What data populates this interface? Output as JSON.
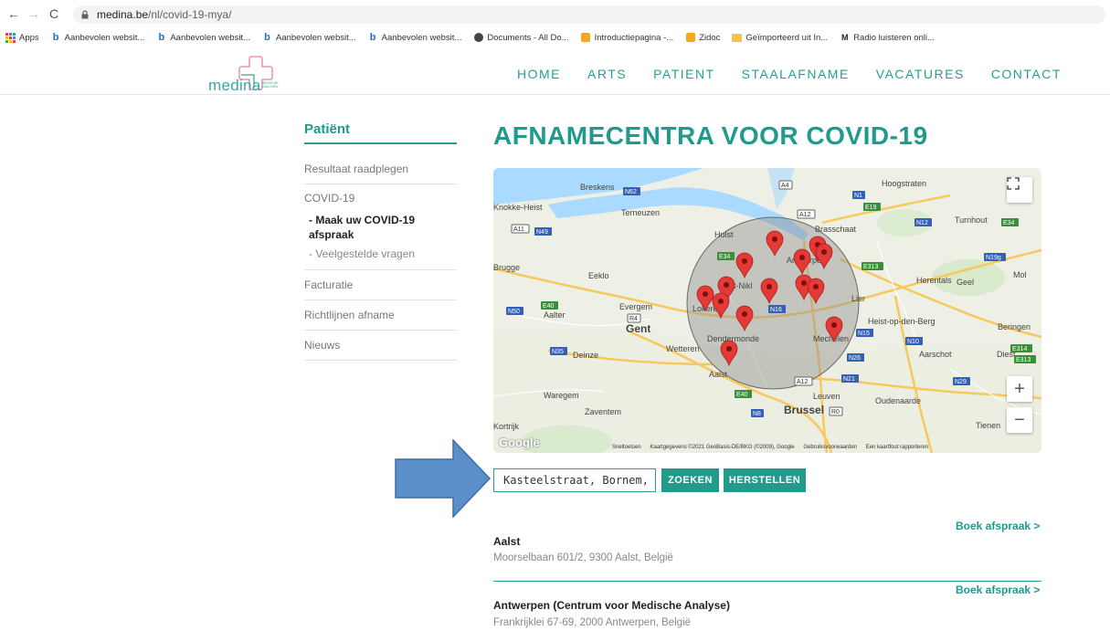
{
  "browser": {
    "url_host": "medina.be",
    "url_path": "/nl/covid-19-mya/",
    "bookmarks": [
      {
        "label": "Apps",
        "icon": "apps-grid-icon"
      },
      {
        "label": "Aanbevolen websit...",
        "icon": "bing-icon"
      },
      {
        "label": "Aanbevolen websit...",
        "icon": "bing-icon"
      },
      {
        "label": "Aanbevolen websit...",
        "icon": "bing-icon"
      },
      {
        "label": "Aanbevolen websit...",
        "icon": "bing-icon"
      },
      {
        "label": "Documents - All Do...",
        "icon": "documents-icon"
      },
      {
        "label": "Introductiepagina -...",
        "icon": "page-icon"
      },
      {
        "label": "Zidoc",
        "icon": "page-icon"
      },
      {
        "label": "Geïmporteerd uit In...",
        "icon": "folder-icon"
      },
      {
        "label": "Radio luisteren onli...",
        "icon": "radio-icon"
      }
    ]
  },
  "site": {
    "logo_text": "medina",
    "logo_sub": "MEDISCHE ANALYSEN",
    "nav": [
      "HOME",
      "ARTS",
      "PATIENT",
      "STAALAFNAME",
      "VACATURES",
      "CONTACT"
    ]
  },
  "sidebar": {
    "title": "Patiënt",
    "items": [
      "Resultaat raadplegen",
      "COVID-19",
      "Facturatie",
      "Richtlijnen afname",
      "Nieuws"
    ],
    "sub_active": "- Maak uw COVID-19 afspraak",
    "sub_other": "- Veelgestelde vragen"
  },
  "main": {
    "title": "AFNAMECENTRA VOOR COVID-19",
    "map": {
      "place_labels": [
        "Breskens",
        "Knokke-Heist",
        "Terneuzen",
        "Hulst",
        "Brasschaat",
        "Hoogstraten",
        "Turnhout",
        "Brugge",
        "Eeklo",
        "Sint-Nikl",
        "Antwerpen",
        "Herentals",
        "Geel",
        "Mol",
        "Evergem",
        "Aalter",
        "Gent",
        "Lokeren",
        "Lier",
        "Heist-op-den-Berg",
        "Beringen",
        "Wetteren",
        "Dendermonde",
        "Mechelen",
        "Deinze",
        "Aarschot",
        "Diest",
        "Aalst",
        "Waregem",
        "Zaventem",
        "Leuven",
        "Oudenaarde",
        "Brussel",
        "Kortrijk",
        "Tienen"
      ],
      "road_labels": [
        "N62",
        "A4",
        "N1",
        "E19",
        "A12",
        "N12",
        "E34",
        "A11",
        "N49",
        "E34",
        "N19g",
        "E313",
        "E40",
        "N50",
        "N16",
        "N15",
        "N10",
        "N35",
        "N26",
        "E314",
        "N21",
        "E40",
        "N8",
        "R0",
        "N29",
        "A12",
        "R4",
        "E313"
      ],
      "attribution": [
        "Sneltoetsen",
        "Kaartgegevens ©2021 GeoBasis-DE/BKG (©2009), Google",
        "Gebruiksvoorwaarden",
        "Een kaartfout rapporteren"
      ],
      "google": "Google",
      "zoom_in": "+",
      "zoom_out": "−"
    },
    "search_value": "Kasteelstraat, Bornem, Belgi",
    "search_btn": "ZOEKEN",
    "reset_btn": "HERSTELLEN",
    "results": [
      {
        "name": "Aalst",
        "address": "Moorselbaan 601/2, 9300 Aalst, België",
        "link": "Boek afspraak >"
      },
      {
        "name": "Antwerpen (Centrum voor Medische Analyse)",
        "address": "Frankrijklei 67-69, 2000 Antwerpen, België",
        "link": "Boek afspraak >"
      }
    ]
  },
  "colors": {
    "accent": "#1f9a8c",
    "arrow": "#5b8fc9"
  }
}
